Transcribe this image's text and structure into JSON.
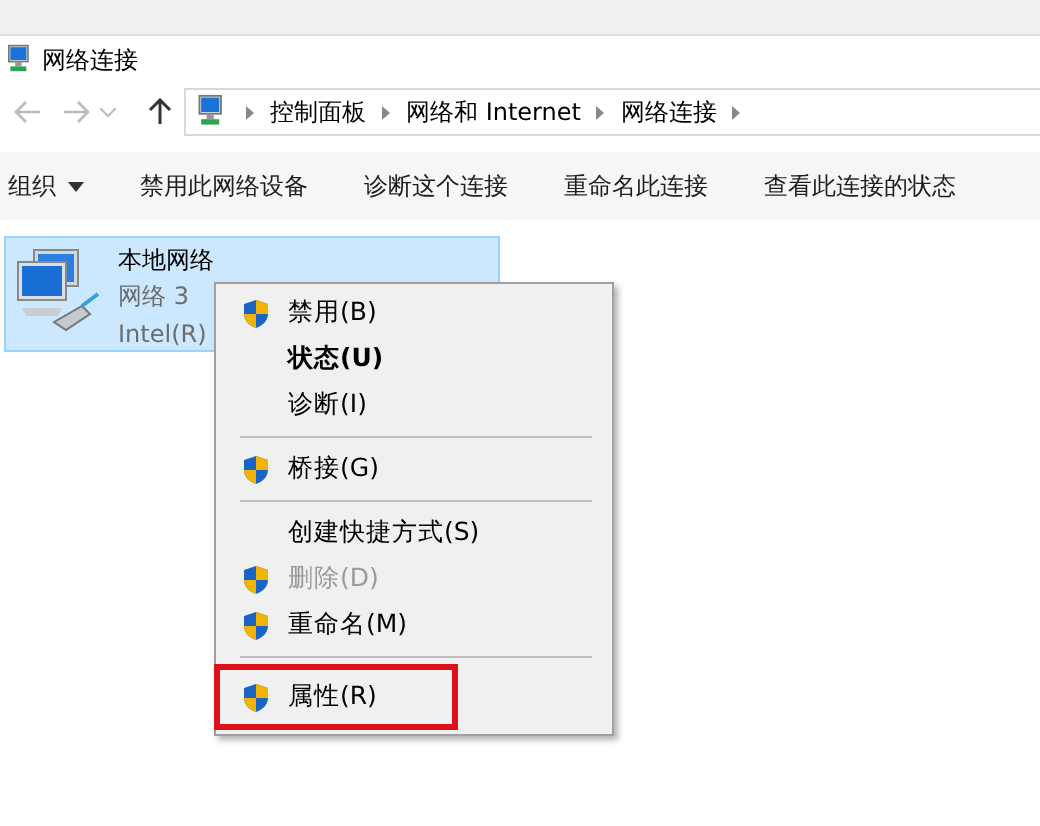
{
  "window": {
    "title": "网络连接"
  },
  "nav": {
    "back": {
      "disabled": true
    },
    "forward": {
      "disabled": true
    },
    "up": {
      "disabled": false
    }
  },
  "breadcrumb": [
    "控制面板",
    "网络和 Internet",
    "网络连接"
  ],
  "toolbar": [
    {
      "label": "组织",
      "dropdown": true
    },
    {
      "label": "禁用此网络设备",
      "dropdown": false
    },
    {
      "label": "诊断这个连接",
      "dropdown": false
    },
    {
      "label": "重命名此连接",
      "dropdown": false
    },
    {
      "label": "查看此连接的状态",
      "dropdown": false
    }
  ],
  "connection": {
    "name": "本地网络",
    "network": "网络 3",
    "adapter": "Intel(R)",
    "selected": true
  },
  "context_menu": [
    {
      "kind": "item",
      "label": "禁用(B)",
      "shield": true,
      "bold": false,
      "disabled": false,
      "annotated": false
    },
    {
      "kind": "item",
      "label": "状态(U)",
      "shield": false,
      "bold": true,
      "disabled": false,
      "annotated": false
    },
    {
      "kind": "item",
      "label": "诊断(I)",
      "shield": false,
      "bold": false,
      "disabled": false,
      "annotated": false
    },
    {
      "kind": "separator"
    },
    {
      "kind": "item",
      "label": "桥接(G)",
      "shield": true,
      "bold": false,
      "disabled": false,
      "annotated": false
    },
    {
      "kind": "separator"
    },
    {
      "kind": "item",
      "label": "创建快捷方式(S)",
      "shield": false,
      "bold": false,
      "disabled": false,
      "annotated": false
    },
    {
      "kind": "item",
      "label": "删除(D)",
      "shield": true,
      "bold": false,
      "disabled": true,
      "annotated": false
    },
    {
      "kind": "item",
      "label": "重命名(M)",
      "shield": true,
      "bold": false,
      "disabled": false,
      "annotated": false
    },
    {
      "kind": "separator"
    },
    {
      "kind": "item",
      "label": "属性(R)",
      "shield": true,
      "bold": false,
      "disabled": false,
      "annotated": true
    }
  ]
}
